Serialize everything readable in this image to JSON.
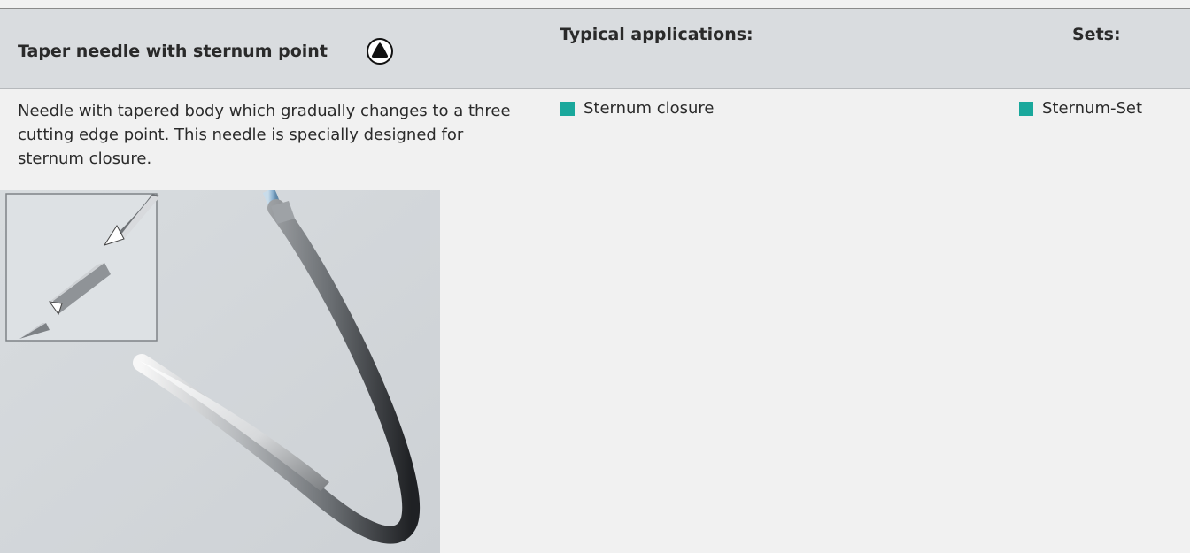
{
  "header": {
    "title": "Taper needle with sternum point",
    "title_icon": "triangle-in-circle-icon",
    "applications_heading": "Typical applications:",
    "sets_heading": "Sets:"
  },
  "description": "Needle with tapered body which gradually changes to a three cutting edge point. This needle is specially designed for sternum closure.",
  "applications": [
    {
      "label": "Sternum closure"
    }
  ],
  "sets": [
    {
      "label": "Sternum-Set"
    }
  ],
  "colors": {
    "accent_bullet": "#1aa89c",
    "header_background": "#d9dcdf",
    "page_background": "#f1f1f1",
    "figure_background": "#d4d8dc"
  },
  "figure": {
    "subject": "curved-taper-needle-illustration",
    "inset": "needle-point-detail-inset"
  }
}
